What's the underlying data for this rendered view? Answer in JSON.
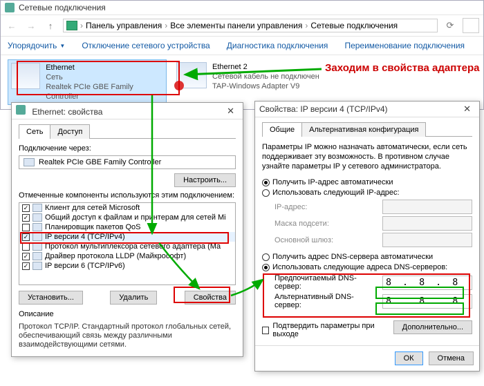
{
  "main": {
    "title": "Сетевые подключения",
    "breadcrumb": [
      "Панель управления",
      "Все элементы панели управления",
      "Сетевые подключения"
    ],
    "commands": {
      "organize": "Упорядочить",
      "disable": "Отключение сетевого устройства",
      "diagnose": "Диагностика подключения",
      "rename": "Переименование подключения"
    },
    "adapters": [
      {
        "name": "Ethernet",
        "status": "Сеть",
        "device": "Realtek PCIe GBE Family Controller"
      },
      {
        "name": "Ethernet 2",
        "status": "Сетевой кабель не подключен",
        "device": "TAP-Windows Adapter V9"
      }
    ]
  },
  "annotation": "Заходим в свойства адаптера",
  "props": {
    "title": "Ethernet: свойства",
    "tabs": [
      "Сеть",
      "Доступ"
    ],
    "connect_via": "Подключение через:",
    "adapter": "Realtek PCIe GBE Family Controller",
    "configure": "Настроить...",
    "components_label": "Отмеченные компоненты используются этим подключением:",
    "components": [
      {
        "checked": true,
        "label": "Клиент для сетей Microsoft"
      },
      {
        "checked": true,
        "label": "Общий доступ к файлам и принтерам для сетей Mi"
      },
      {
        "checked": false,
        "label": "Планировщик пакетов QoS"
      },
      {
        "checked": true,
        "label": "IP версии 4 (TCP/IPv4)",
        "highlight": true
      },
      {
        "checked": false,
        "label": "Протокол мультиплексора сетевого адаптера (Ма"
      },
      {
        "checked": true,
        "label": "Драйвер протокола LLDP (Майкрософт)"
      },
      {
        "checked": true,
        "label": "IP версии 6 (TCP/IPv6)"
      }
    ],
    "install": "Установить...",
    "remove": "Удалить",
    "properties": "Свойства",
    "desc_header": "Описание",
    "desc": "Протокол TCP/IP. Стандартный протокол глобальных сетей, обеспечивающий связь между различными взаимодействующими сетями."
  },
  "ipv4": {
    "title": "Свойства: IP версии 4 (TCP/IPv4)",
    "tabs": [
      "Общие",
      "Альтернативная конфигурация"
    ],
    "blurb": "Параметры IP можно назначать автоматически, если сеть поддерживает эту возможность. В противном случае узнайте параметры IP у сетевого администратора.",
    "ip_auto": "Получить IP-адрес автоматически",
    "ip_manual": "Использовать следующий IP-адрес:",
    "ip_label": "IP-адрес:",
    "mask_label": "Маска подсети:",
    "gw_label": "Основной шлюз:",
    "dns_auto": "Получить адрес DNS-сервера автоматически",
    "dns_manual": "Использовать следующие адреса DNS-серверов:",
    "dns1_label": "Предпочитаемый DNS-сервер:",
    "dns2_label": "Альтернативный DNS-сервер:",
    "dns1": "8 . 8 . 8 . 8",
    "dns2": "8 . 8 . 8 . 4",
    "validate": "Подтвердить параметры при выходе",
    "advanced": "Дополнительно...",
    "ok": "ОК",
    "cancel": "Отмена"
  }
}
